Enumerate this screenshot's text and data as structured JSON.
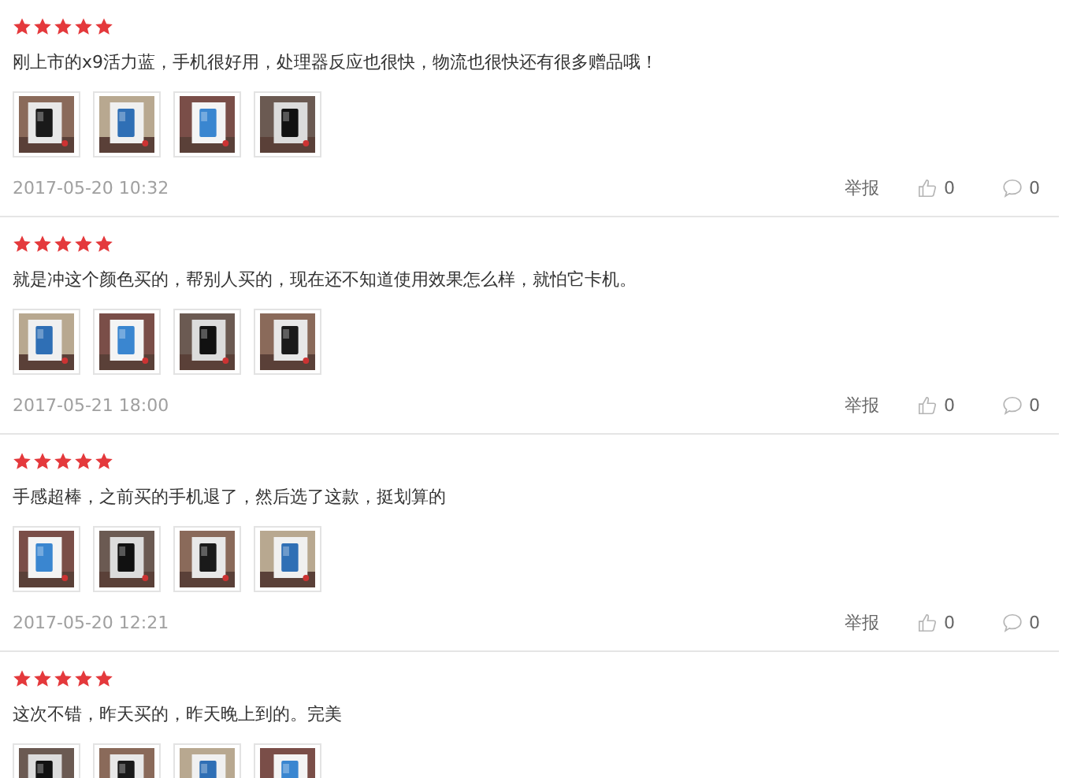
{
  "reviews": [
    {
      "stars": 5,
      "text": "刚上市的x9活力蓝，手机很好用，处理器反应也很快，物流也很快还有很多赠品哦！",
      "images": [
        {
          "kind": "picture"
        },
        {
          "kind": "picture"
        },
        {
          "kind": "picture"
        },
        {
          "kind": "picture"
        }
      ],
      "date": "2017-05-20 10:32",
      "report": "举报",
      "likes": "0",
      "comments": "0"
    },
    {
      "stars": 5,
      "text": "就是冲这个颜色买的，帮别人买的，现在还不知道使用效果怎么样，就怕它卡机。",
      "images": [
        {
          "kind": "picture"
        },
        {
          "kind": "picture"
        },
        {
          "kind": "picture"
        },
        {
          "kind": "picture"
        }
      ],
      "date": "2017-05-21 18:00",
      "report": "举报",
      "likes": "0",
      "comments": "0"
    },
    {
      "stars": 5,
      "text": "手感超棒，之前买的手机退了，然后选了这款，挺划算的",
      "images": [
        {
          "kind": "picture"
        },
        {
          "kind": "picture"
        },
        {
          "kind": "picture"
        },
        {
          "kind": "picture"
        }
      ],
      "date": "2017-05-20 12:21",
      "report": "举报",
      "likes": "0",
      "comments": "0"
    },
    {
      "stars": 5,
      "text": "这次不错，昨天买的，昨天晚上到的。完美",
      "images": [
        {
          "kind": "picture"
        },
        {
          "kind": "picture"
        },
        {
          "kind": "picture"
        },
        {
          "kind": "picture"
        }
      ]
    }
  ]
}
